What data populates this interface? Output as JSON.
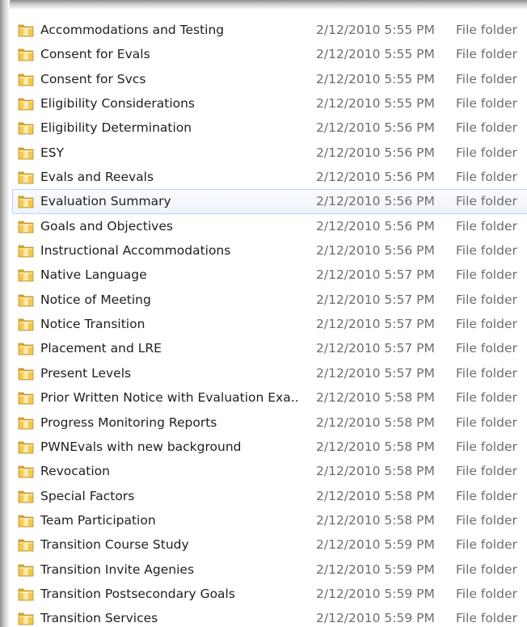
{
  "files": [
    {
      "name": "Accommodations and Testing",
      "date": "2/12/2010 5:55 PM",
      "type": "File folder"
    },
    {
      "name": "Consent for Evals",
      "date": "2/12/2010 5:55 PM",
      "type": "File folder"
    },
    {
      "name": "Consent for Svcs",
      "date": "2/12/2010 5:55 PM",
      "type": "File folder"
    },
    {
      "name": "Eligibility Considerations",
      "date": "2/12/2010 5:55 PM",
      "type": "File folder"
    },
    {
      "name": "Eligibility Determination",
      "date": "2/12/2010 5:56 PM",
      "type": "File folder"
    },
    {
      "name": "ESY",
      "date": "2/12/2010 5:56 PM",
      "type": "File folder"
    },
    {
      "name": "Evals and Reevals",
      "date": "2/12/2010 5:56 PM",
      "type": "File folder"
    },
    {
      "name": "Evaluation Summary",
      "date": "2/12/2010 5:56 PM",
      "type": "File folder",
      "hovered": true
    },
    {
      "name": "Goals and Objectives",
      "date": "2/12/2010 5:56 PM",
      "type": "File folder"
    },
    {
      "name": "Instructional Accommodations",
      "date": "2/12/2010 5:56 PM",
      "type": "File folder"
    },
    {
      "name": "Native Language",
      "date": "2/12/2010 5:57 PM",
      "type": "File folder"
    },
    {
      "name": "Notice of Meeting",
      "date": "2/12/2010 5:57 PM",
      "type": "File folder"
    },
    {
      "name": "Notice Transition",
      "date": "2/12/2010 5:57 PM",
      "type": "File folder"
    },
    {
      "name": "Placement and LRE",
      "date": "2/12/2010 5:57 PM",
      "type": "File folder"
    },
    {
      "name": "Present Levels",
      "date": "2/12/2010 5:57 PM",
      "type": "File folder"
    },
    {
      "name": "Prior Written Notice with Evaluation Exa...",
      "date": "2/12/2010 5:58 PM",
      "type": "File folder"
    },
    {
      "name": "Progress Monitoring Reports",
      "date": "2/12/2010 5:58 PM",
      "type": "File folder"
    },
    {
      "name": "PWNEvals with new background",
      "date": "2/12/2010 5:58 PM",
      "type": "File folder"
    },
    {
      "name": "Revocation",
      "date": "2/12/2010 5:58 PM",
      "type": "File folder"
    },
    {
      "name": "Special Factors",
      "date": "2/12/2010 5:58 PM",
      "type": "File folder"
    },
    {
      "name": "Team Participation",
      "date": "2/12/2010 5:58 PM",
      "type": "File folder"
    },
    {
      "name": "Transition Course Study",
      "date": "2/12/2010 5:59 PM",
      "type": "File folder"
    },
    {
      "name": "Transition Invite Agenies",
      "date": "2/12/2010 5:59 PM",
      "type": "File folder"
    },
    {
      "name": "Transition Postsecondary Goals",
      "date": "2/12/2010 5:59 PM",
      "type": "File folder"
    },
    {
      "name": "Transition Services",
      "date": "2/12/2010 5:59 PM",
      "type": "File folder"
    }
  ],
  "icons": {
    "folder": "folder-icon"
  },
  "colors": {
    "hover_border": "#b8d6fb",
    "folder_yellow": "#f2c94c"
  }
}
